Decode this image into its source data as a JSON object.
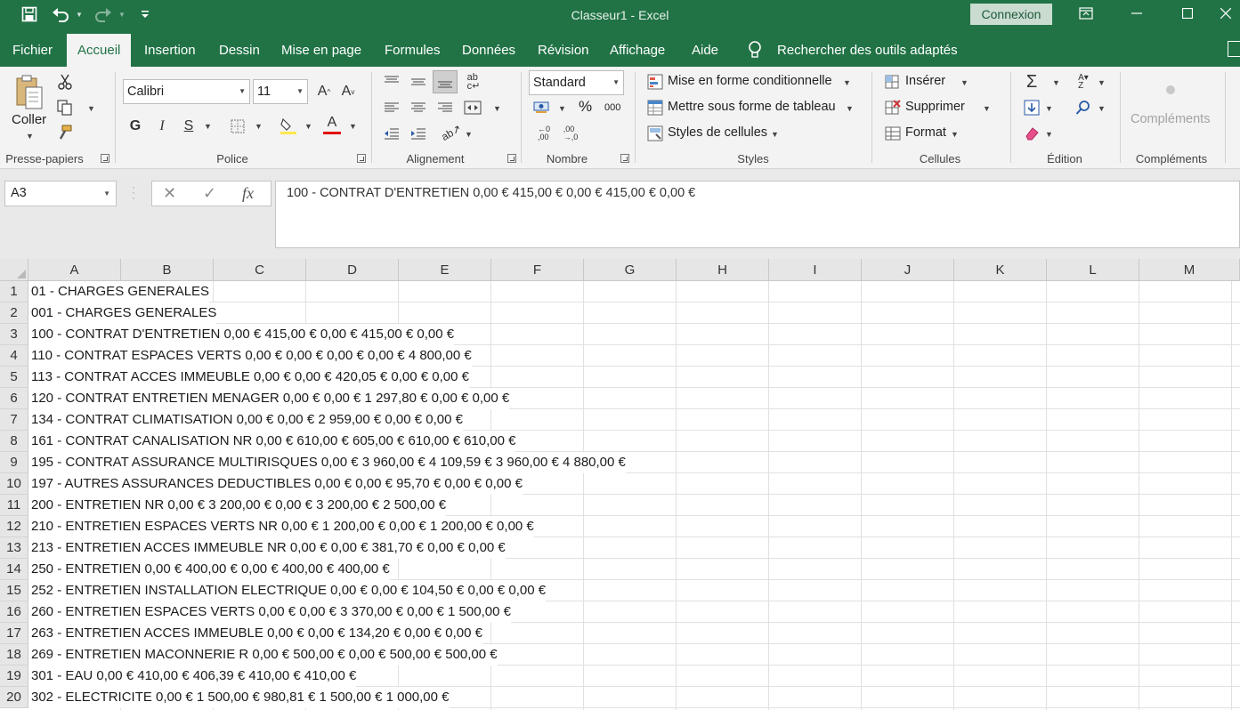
{
  "app": {
    "title": "Classeur1  -  Excel",
    "connexion_label": "Connexion",
    "accent_color": "#217346"
  },
  "quick_access": [
    "save-icon",
    "undo-icon",
    "redo-icon",
    "customize-qa-icon"
  ],
  "tabs": [
    {
      "label": "Fichier",
      "active": false
    },
    {
      "label": "Accueil",
      "active": true
    },
    {
      "label": "Insertion",
      "active": false
    },
    {
      "label": "Dessin",
      "active": false
    },
    {
      "label": "Mise en page",
      "active": false
    },
    {
      "label": "Formules",
      "active": false
    },
    {
      "label": "Données",
      "active": false
    },
    {
      "label": "Révision",
      "active": false
    },
    {
      "label": "Affichage",
      "active": false
    },
    {
      "label": "Aide",
      "active": false
    }
  ],
  "search_label": "Rechercher des outils adaptés",
  "ribbon": {
    "clipboard": {
      "label": "Presse-papiers",
      "paste_label": "Coller"
    },
    "font": {
      "label": "Police",
      "font_name": "Calibri",
      "font_size": "11"
    },
    "alignment": {
      "label": "Alignement"
    },
    "number": {
      "label": "Nombre",
      "format": "Standard",
      "percent": "%",
      "thousands": "000"
    },
    "styles": {
      "label": "Styles",
      "conditional": "Mise en forme conditionnelle",
      "table": "Mettre sous forme de tableau",
      "cell_styles": "Styles de cellules"
    },
    "cells": {
      "label": "Cellules",
      "insert": "Insérer",
      "delete": "Supprimer",
      "format": "Format"
    },
    "editing": {
      "label": "Édition"
    },
    "addins": {
      "label": "Compléments",
      "button": "Compléments"
    }
  },
  "formula_bar": {
    "name_box": "A3",
    "content": "100 - CONTRAT D'ENTRETIEN 0,00 € 415,00 € 0,00 € 415,00 € 0,00 €"
  },
  "sheet": {
    "columns": [
      "A",
      "B",
      "C",
      "D",
      "E",
      "F",
      "G",
      "H",
      "I",
      "J",
      "K",
      "L",
      "M"
    ],
    "rows": [
      {
        "n": "1",
        "a": "01 - CHARGES GENERALES"
      },
      {
        "n": "2",
        "a": "001 - CHARGES GENERALES"
      },
      {
        "n": "3",
        "a": "100 - CONTRAT D'ENTRETIEN 0,00 € 415,00 € 0,00 € 415,00 € 0,00 €"
      },
      {
        "n": "4",
        "a": "110 - CONTRAT ESPACES VERTS 0,00 € 0,00 € 0,00 € 0,00 € 4 800,00 €"
      },
      {
        "n": "5",
        "a": "113 - CONTRAT ACCES IMMEUBLE 0,00 € 0,00 € 420,05 € 0,00 € 0,00 €"
      },
      {
        "n": "6",
        "a": "120 - CONTRAT ENTRETIEN MENAGER 0,00 € 0,00 € 1 297,80 € 0,00 € 0,00 €"
      },
      {
        "n": "7",
        "a": "134 - CONTRAT CLIMATISATION 0,00 € 0,00 € 2 959,00 € 0,00 € 0,00 €"
      },
      {
        "n": "8",
        "a": "161 - CONTRAT CANALISATION NR 0,00 € 610,00 € 605,00 € 610,00 € 610,00 €"
      },
      {
        "n": "9",
        "a": "195 - CONTRAT ASSURANCE MULTIRISQUES 0,00 € 3 960,00 € 4 109,59 € 3 960,00 € 4 880,00 €"
      },
      {
        "n": "10",
        "a": "197 - AUTRES ASSURANCES DEDUCTIBLES 0,00 € 0,00 € 95,70 € 0,00 € 0,00 €"
      },
      {
        "n": "11",
        "a": "200 - ENTRETIEN NR 0,00 € 3 200,00 € 0,00 € 3 200,00 € 2 500,00 €"
      },
      {
        "n": "12",
        "a": "210 - ENTRETIEN ESPACES VERTS NR 0,00 € 1 200,00 € 0,00 € 1 200,00 € 0,00 €"
      },
      {
        "n": "13",
        "a": "213 - ENTRETIEN ACCES IMMEUBLE NR 0,00 € 0,00 € 381,70 € 0,00 € 0,00 €"
      },
      {
        "n": "14",
        "a": "250 - ENTRETIEN 0,00 € 400,00 € 0,00 € 400,00 € 400,00 €"
      },
      {
        "n": "15",
        "a": "252 - ENTRETIEN INSTALLATION ELECTRIQUE 0,00 € 0,00 € 104,50 € 0,00 € 0,00 €"
      },
      {
        "n": "16",
        "a": "260 - ENTRETIEN ESPACES VERTS 0,00 € 0,00 € 3 370,00 € 0,00 € 1 500,00 €"
      },
      {
        "n": "17",
        "a": "263 - ENTRETIEN ACCES IMMEUBLE 0,00 € 0,00 € 134,20 € 0,00 € 0,00 €"
      },
      {
        "n": "18",
        "a": "269 - ENTRETIEN MACONNERIE R 0,00 € 500,00 € 0,00 € 500,00 € 500,00 €"
      },
      {
        "n": "19",
        "a": "301 - EAU 0,00 € 410,00 € 406,39 € 410,00 € 410,00 €"
      },
      {
        "n": "20",
        "a": "302 - ELECTRICITE 0,00 € 1 500,00 € 980,81 € 1 500,00 € 1 000,00 €"
      }
    ]
  }
}
